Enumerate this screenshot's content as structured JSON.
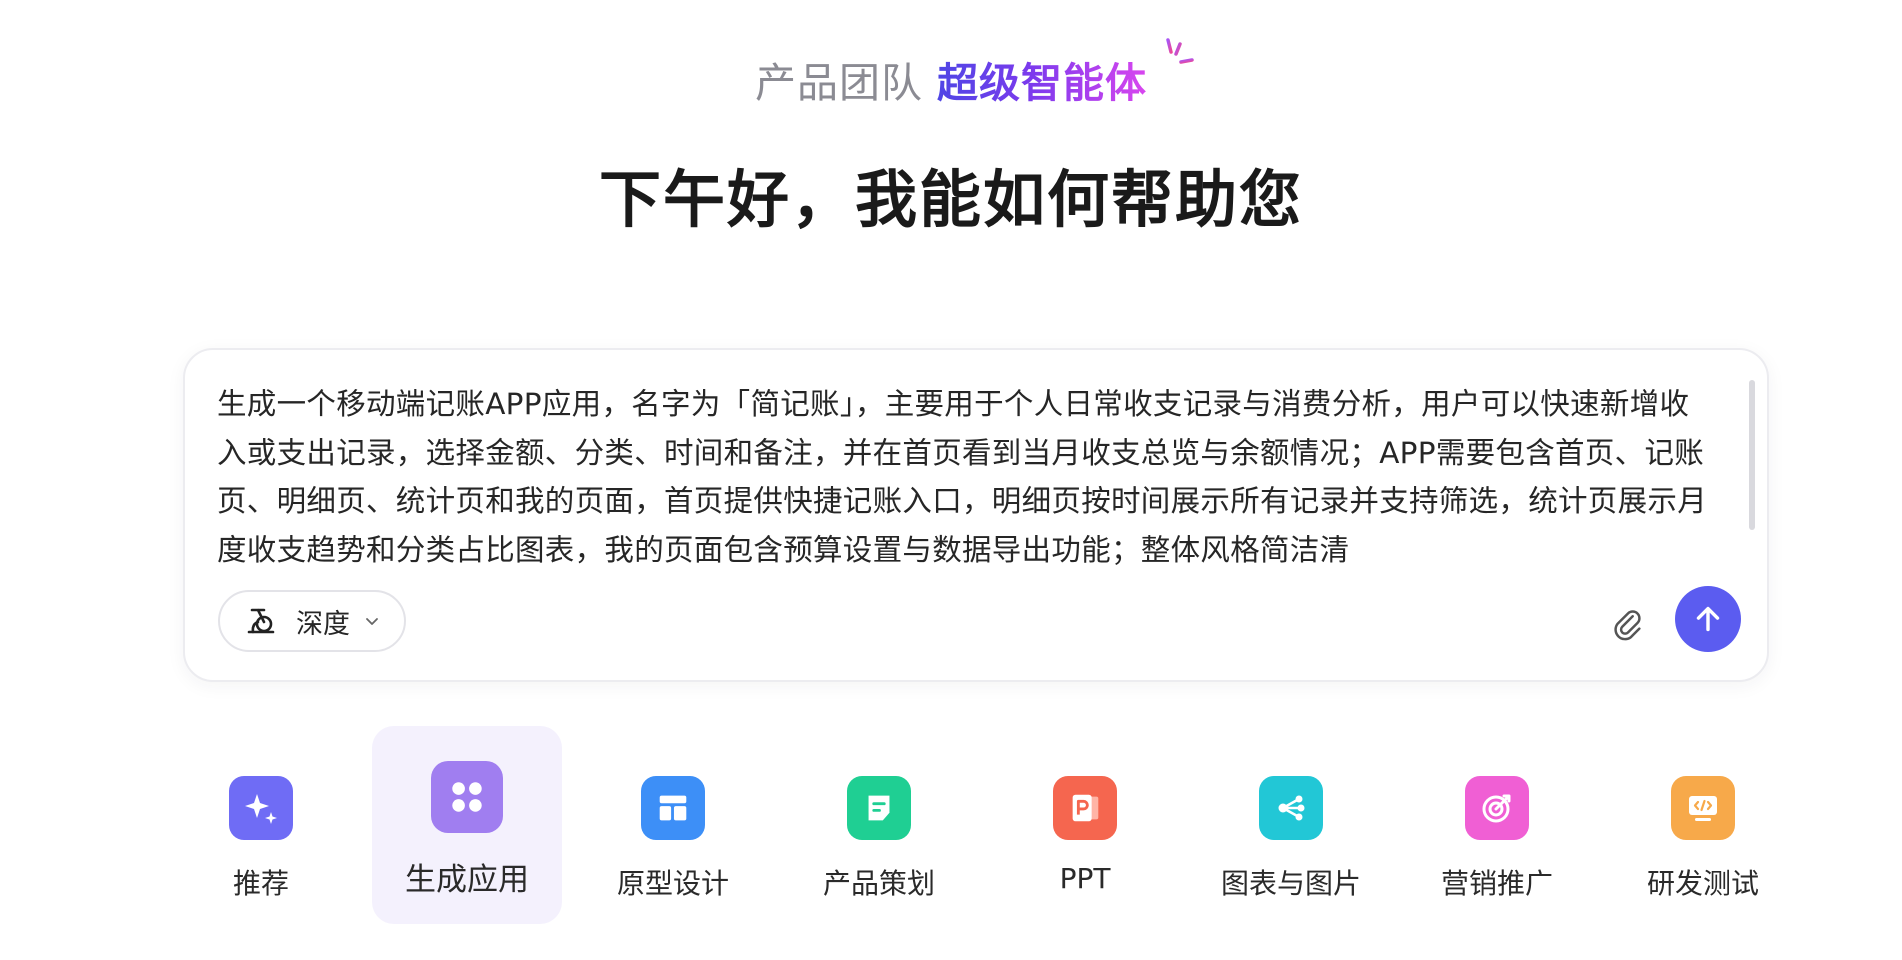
{
  "header": {
    "team": "产品团队",
    "agent": "超级智能体",
    "sparkle_icon": "sparkle-icon"
  },
  "greeting": "下午好，我能如何帮助您",
  "composer": {
    "prompt": "生成一个移动端记账APP应用，名字为「简记账」，主要用于个人日常收支记录与消费分析，用户可以快速新增收入或支出记录，选择金额、分类、时间和备注，并在首页看到当月收支总览与余额情况；APP需要包含首页、记账页、明细页、统计页和我的页面，首页提供快捷记账入口，明细页按时间展示所有记录并支持筛选，统计页展示月度收支趋势和分类占比图表，我的页面包含预算设置与数据导出功能；整体风格简洁清",
    "mode_label": "深度",
    "mode_icon": "deep-think-icon",
    "attach_icon": "paperclip-icon",
    "send_icon": "arrow-up-icon",
    "send_color": "#5b5cf0"
  },
  "categories": [
    {
      "label": "推荐",
      "icon": "sparkle-icon",
      "color": "#6f6cf5",
      "active": false
    },
    {
      "label": "生成应用",
      "icon": "grid-apps-icon",
      "color": "#a07ef0",
      "active": true
    },
    {
      "label": "原型设计",
      "icon": "layout-icon",
      "color": "#3d8ff7",
      "active": false
    },
    {
      "label": "产品策划",
      "icon": "document-icon",
      "color": "#1fcf93",
      "active": false
    },
    {
      "label": "PPT",
      "icon": "ppt-icon",
      "color": "#f5664f",
      "active": false
    },
    {
      "label": "图表与图片",
      "icon": "share-nodes-icon",
      "color": "#22c7d6",
      "active": false
    },
    {
      "label": "营销推广",
      "icon": "target-icon",
      "color": "#f05fd4",
      "active": false
    },
    {
      "label": "研发测试",
      "icon": "code-monitor-icon",
      "color": "#f7a94a",
      "active": false
    }
  ]
}
